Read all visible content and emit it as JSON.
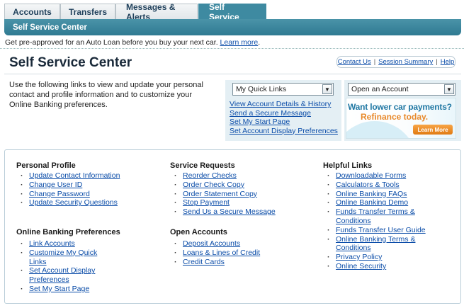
{
  "tabs": [
    "Accounts",
    "Transfers",
    "Messages & Alerts",
    "Self Service"
  ],
  "subnav": "Self Service Center",
  "promo": {
    "text": "Get pre-approved for an Auto Loan before you buy your next car.",
    "link": "Learn more",
    "end": "."
  },
  "page_title": "Self Service Center",
  "utility": {
    "contact": "Contact Us",
    "session": "Session Summary",
    "help": "Help",
    "sep": "|"
  },
  "intro": "Use the following links to view and update your personal contact and profile information and to customize your Online Banking preferences.",
  "quick_links": {
    "select_value": "My Quick Links",
    "links": [
      "View Account Details & History",
      "Send a Secure Message",
      "Set My Start Page",
      "Set Account Display Preferences"
    ]
  },
  "open_account": {
    "select_value": "Open an Account",
    "ad_line1": "Want lower car payments?",
    "ad_line2": "Refinance today.",
    "ad_button": "Learn More"
  },
  "sections": {
    "personal": {
      "title": "Personal Profile",
      "items": [
        "Update Contact Information",
        "Change User ID",
        "Change Password",
        "Update Security Questions"
      ]
    },
    "service": {
      "title": "Service Requests",
      "items": [
        "Reorder Checks",
        "Order Check Copy",
        "Order Statement Copy",
        "Stop Payment",
        "Send Us a Secure Message"
      ]
    },
    "helpful": {
      "title": "Helpful Links",
      "items": [
        "Downloadable Forms",
        "Calculators & Tools",
        "Online Banking FAQs",
        "Online Banking Demo",
        "Funds Transfer Terms & Conditions",
        "Funds Transfer User Guide",
        "Online Banking Terms & Conditions",
        "Privacy Policy",
        "Online Security"
      ]
    },
    "obp": {
      "title": "Online Banking Preferences",
      "items": [
        "Link Accounts",
        "Customize My Quick Links",
        "Set Account Display Preferences",
        "Set My Start Page"
      ]
    },
    "open": {
      "title": "Open Accounts",
      "items": [
        "Deposit Accounts",
        "Loans & Lines of Credit",
        "Credit Cards"
      ]
    }
  },
  "colors": {
    "accent": "#3e8aa1",
    "link": "#0a4ca8",
    "panel": "#e4eff4",
    "ad_orange": "#e8892b"
  }
}
